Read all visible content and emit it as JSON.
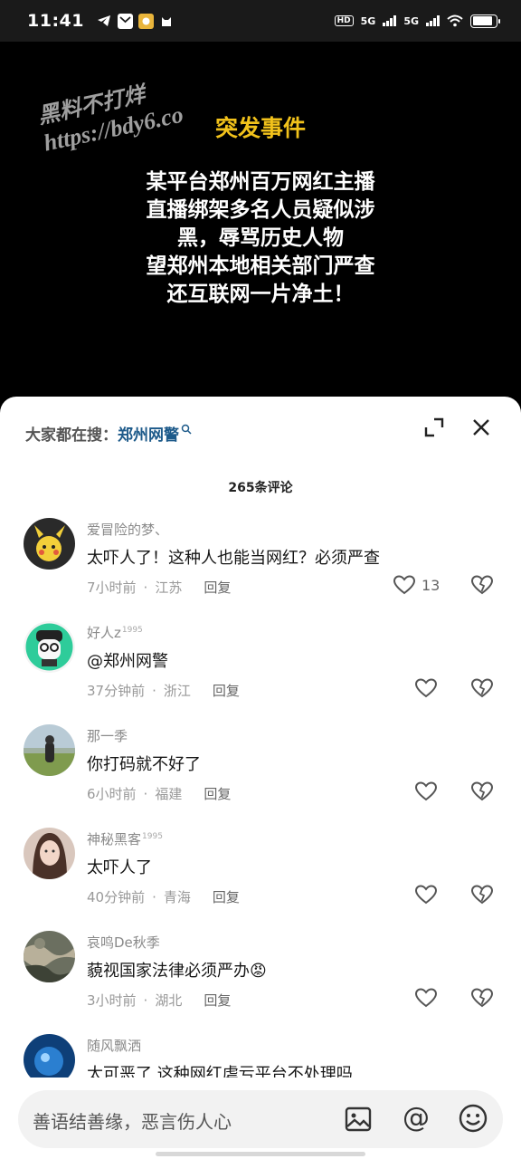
{
  "status_bar": {
    "time": "11:41",
    "hd_label": "HD",
    "net1": "5G",
    "net2": "5G",
    "battery_level": 0.85
  },
  "video": {
    "watermark_line1": "黑料不打烊",
    "watermark_line2": "https://bdy6.co",
    "title": "突发事件",
    "lines": [
      "某平台郑州百万网红主播",
      "直播绑架多名人员疑似涉",
      "黑，辱骂历史人物",
      "望郑州本地相关部门严查",
      "还互联网一片净土！"
    ]
  },
  "sheet": {
    "search_prefix": "大家都在搜：",
    "search_term": "郑州网警",
    "comment_count": "265条评论"
  },
  "comments": [
    {
      "name": "爱冒险的梦、",
      "badge": "",
      "text": "太吓人了！这种人也能当网红？必须严查",
      "time": "7小时前",
      "location": "江苏",
      "reply": "回复",
      "likes": "13"
    },
    {
      "name": "好人z",
      "badge": "1995",
      "text": "@郑州网警",
      "time": "37分钟前",
      "location": "浙江",
      "reply": "回复",
      "likes": ""
    },
    {
      "name": "那一季",
      "badge": "",
      "text": "你打码就不好了",
      "time": "6小时前",
      "location": "福建",
      "reply": "回复",
      "likes": ""
    },
    {
      "name": "神秘黑客",
      "badge": "1995",
      "text": "太吓人了",
      "time": "40分钟前",
      "location": "青海",
      "reply": "回复",
      "likes": ""
    },
    {
      "name": "哀鸣De秋季",
      "badge": "",
      "text": "藐视国家法律必须严办😡",
      "time": "3小时前",
      "location": "湖北",
      "reply": "回复",
      "likes": ""
    },
    {
      "name": "随风飘洒",
      "badge": "",
      "text": "太可恶了 这种网红虐亏平台不处理吗",
      "time": "",
      "location": "",
      "reply": "",
      "likes": ""
    }
  ],
  "input": {
    "placeholder": "善语结善缘，恶言伤人心",
    "at_symbol": "@"
  },
  "colors": {
    "title_yellow": "#f2c21b",
    "search_link": "#1d5a8a"
  },
  "icons": [
    "telegram-icon",
    "mail-icon",
    "app-icon",
    "cat-icon",
    "expand-icon",
    "close-icon",
    "heart-icon",
    "broken-heart-icon",
    "image-icon",
    "emoji-icon"
  ]
}
